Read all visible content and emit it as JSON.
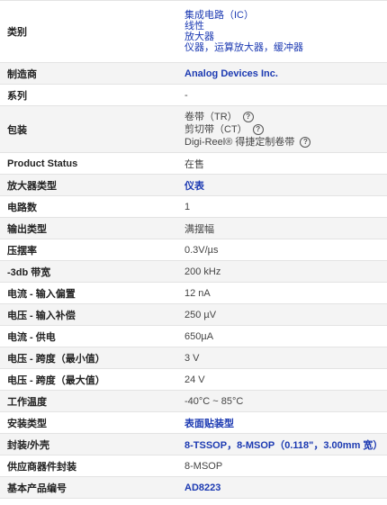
{
  "rows": [
    {
      "label": "类别",
      "values": [
        "集成电路（IC）",
        "线性",
        "放大器",
        "仪器，运算放大器，缓冲器"
      ],
      "kind": "category",
      "height": 69
    },
    {
      "label": "制造商",
      "value": "Analog Devices Inc.",
      "kind": "link",
      "height": 24
    },
    {
      "label": "系列",
      "value": "-",
      "kind": "text",
      "height": 24
    },
    {
      "label": "包装",
      "packaging": [
        "卷带（TR）",
        "剪切带（CT）",
        "Digi-Reel® 得捷定制卷带"
      ],
      "kind": "packaging",
      "height": 52
    },
    {
      "label": "Product Status",
      "value": "在售",
      "kind": "text",
      "height": 24
    },
    {
      "label": "放大器类型",
      "value": "仪表",
      "kind": "link",
      "height": 24
    },
    {
      "label": "电路数",
      "value": "1",
      "kind": "text",
      "height": 24
    },
    {
      "label": "输出类型",
      "value": "满摆幅",
      "kind": "text",
      "height": 24
    },
    {
      "label": "压摆率",
      "value": "0.3V/µs",
      "kind": "text",
      "height": 24
    },
    {
      "label": "-3db 带宽",
      "value": "200 kHz",
      "kind": "text",
      "height": 24
    },
    {
      "label": "电流 - 输入偏置",
      "value": "12 nA",
      "kind": "text",
      "height": 24
    },
    {
      "label": "电压 - 输入补偿",
      "value": "250 µV",
      "kind": "text",
      "height": 24
    },
    {
      "label": "电流 - 供电",
      "value": "650µA",
      "kind": "text",
      "height": 24
    },
    {
      "label": "电压 - 跨度（最小值）",
      "value": "3 V",
      "kind": "text",
      "height": 24
    },
    {
      "label": "电压 - 跨度（最大值）",
      "value": "24 V",
      "kind": "text",
      "height": 24
    },
    {
      "label": "工作温度",
      "value": "-40°C ~ 85°C",
      "kind": "text",
      "height": 24
    },
    {
      "label": "安装类型",
      "value": "表面贴装型",
      "kind": "link",
      "height": 24
    },
    {
      "label": "封装/外壳",
      "value": "8-TSSOP，8-MSOP（0.118\"，3.00mm 宽）",
      "kind": "link",
      "height": 24
    },
    {
      "label": "供应商器件封装",
      "value": "8-MSOP",
      "kind": "text",
      "height": 24
    },
    {
      "label": "基本产品编号",
      "value": "AD8223",
      "kind": "link",
      "height": 24
    }
  ]
}
